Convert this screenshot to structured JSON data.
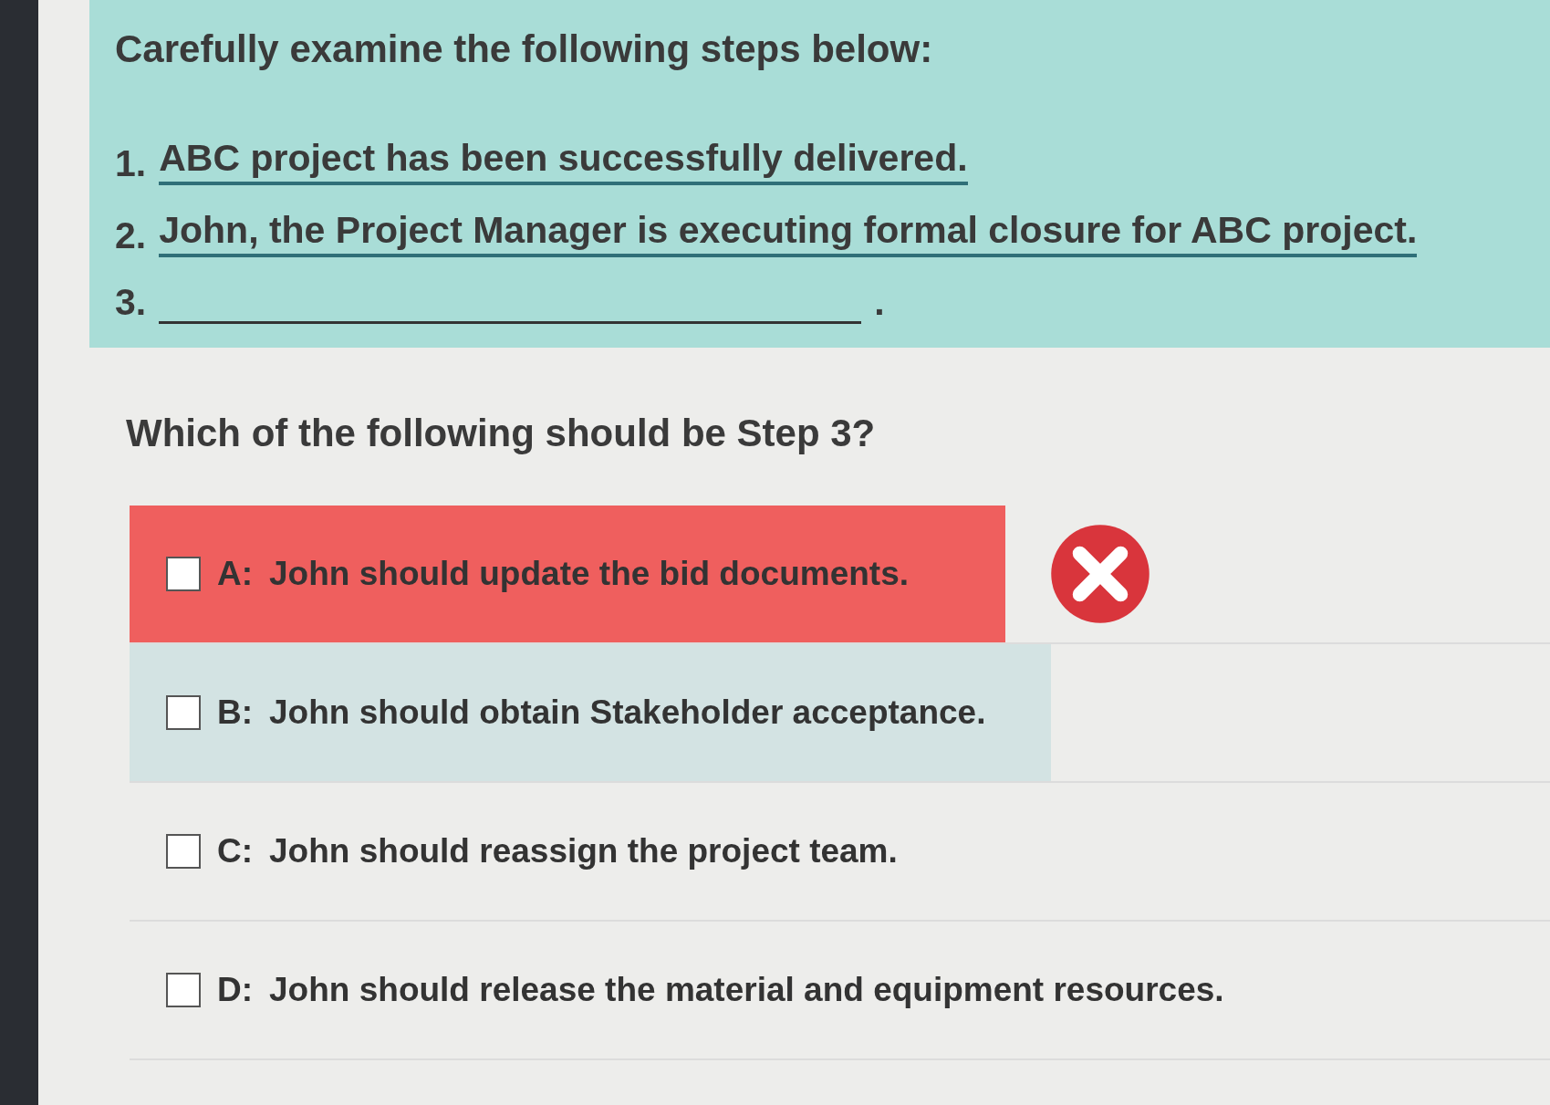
{
  "prompt": {
    "title": "Carefully examine the following steps below:",
    "steps": [
      {
        "number": "1.",
        "text": "ABC project has been successfully delivered.",
        "underlined": true,
        "blank": false
      },
      {
        "number": "2.",
        "text": "John, the Project Manager is executing formal closure for ABC project.",
        "underlined": true,
        "blank": false
      },
      {
        "number": "3.",
        "text": ".",
        "underlined": false,
        "blank": true
      }
    ]
  },
  "question": "Which of the following should be Step 3?",
  "options": [
    {
      "letter": "A:",
      "text": "John should update the bid documents.",
      "checked": false,
      "selected": true,
      "highlighted": false
    },
    {
      "letter": "B:",
      "text": "John should obtain Stakeholder acceptance.",
      "checked": false,
      "selected": false,
      "highlighted": true
    },
    {
      "letter": "C:",
      "text": "John should reassign the project team.",
      "checked": false,
      "selected": false,
      "highlighted": false
    },
    {
      "letter": "D:",
      "text": "John should release the material and equipment resources.",
      "checked": false,
      "selected": false,
      "highlighted": false
    }
  ]
}
